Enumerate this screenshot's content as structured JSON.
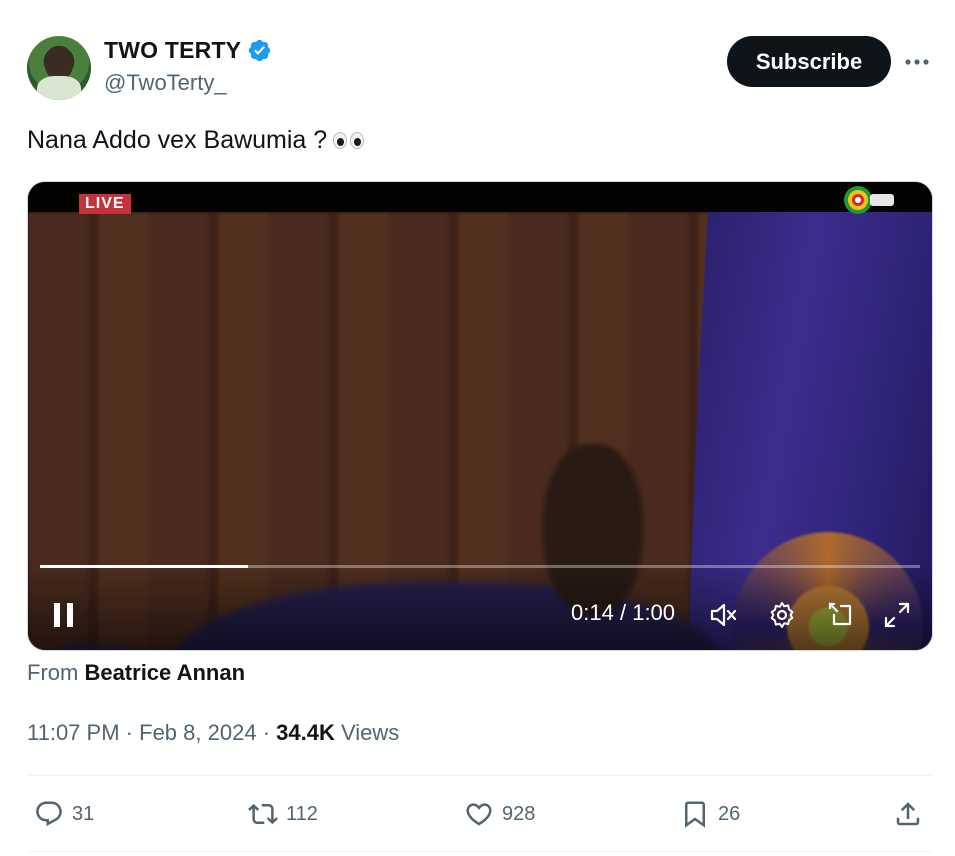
{
  "author": {
    "display_name": "TWO TERTY",
    "handle": "@TwoTerty_",
    "verified": true
  },
  "header": {
    "subscribe_label": "Subscribe",
    "more_icon": "more-horizontal-icon"
  },
  "tweet": {
    "text": "Nana Addo vex Bawumia ?",
    "emoji": "eyes"
  },
  "video": {
    "live_label": "LIVE",
    "current_time": "0:14",
    "separator": "/",
    "duration": "1:00",
    "progress": 0.236,
    "controls": [
      "pause-icon",
      "mute-icon",
      "settings-icon",
      "pip-icon",
      "fullscreen-icon"
    ]
  },
  "source": {
    "prefix": "From",
    "name": "Beatrice Annan"
  },
  "meta": {
    "time": "11:07 PM",
    "dot": "·",
    "date": "Feb 8, 2024",
    "views_count": "34.4K",
    "views_label": "Views"
  },
  "actions": {
    "replies": "31",
    "reposts": "112",
    "likes": "928",
    "bookmarks": "26"
  },
  "colors": {
    "text_primary": "#0f1419",
    "text_secondary": "#536471",
    "verified_blue": "#1d9bf0",
    "button_dark": "#0f1419",
    "live_red": "#c4323b"
  }
}
